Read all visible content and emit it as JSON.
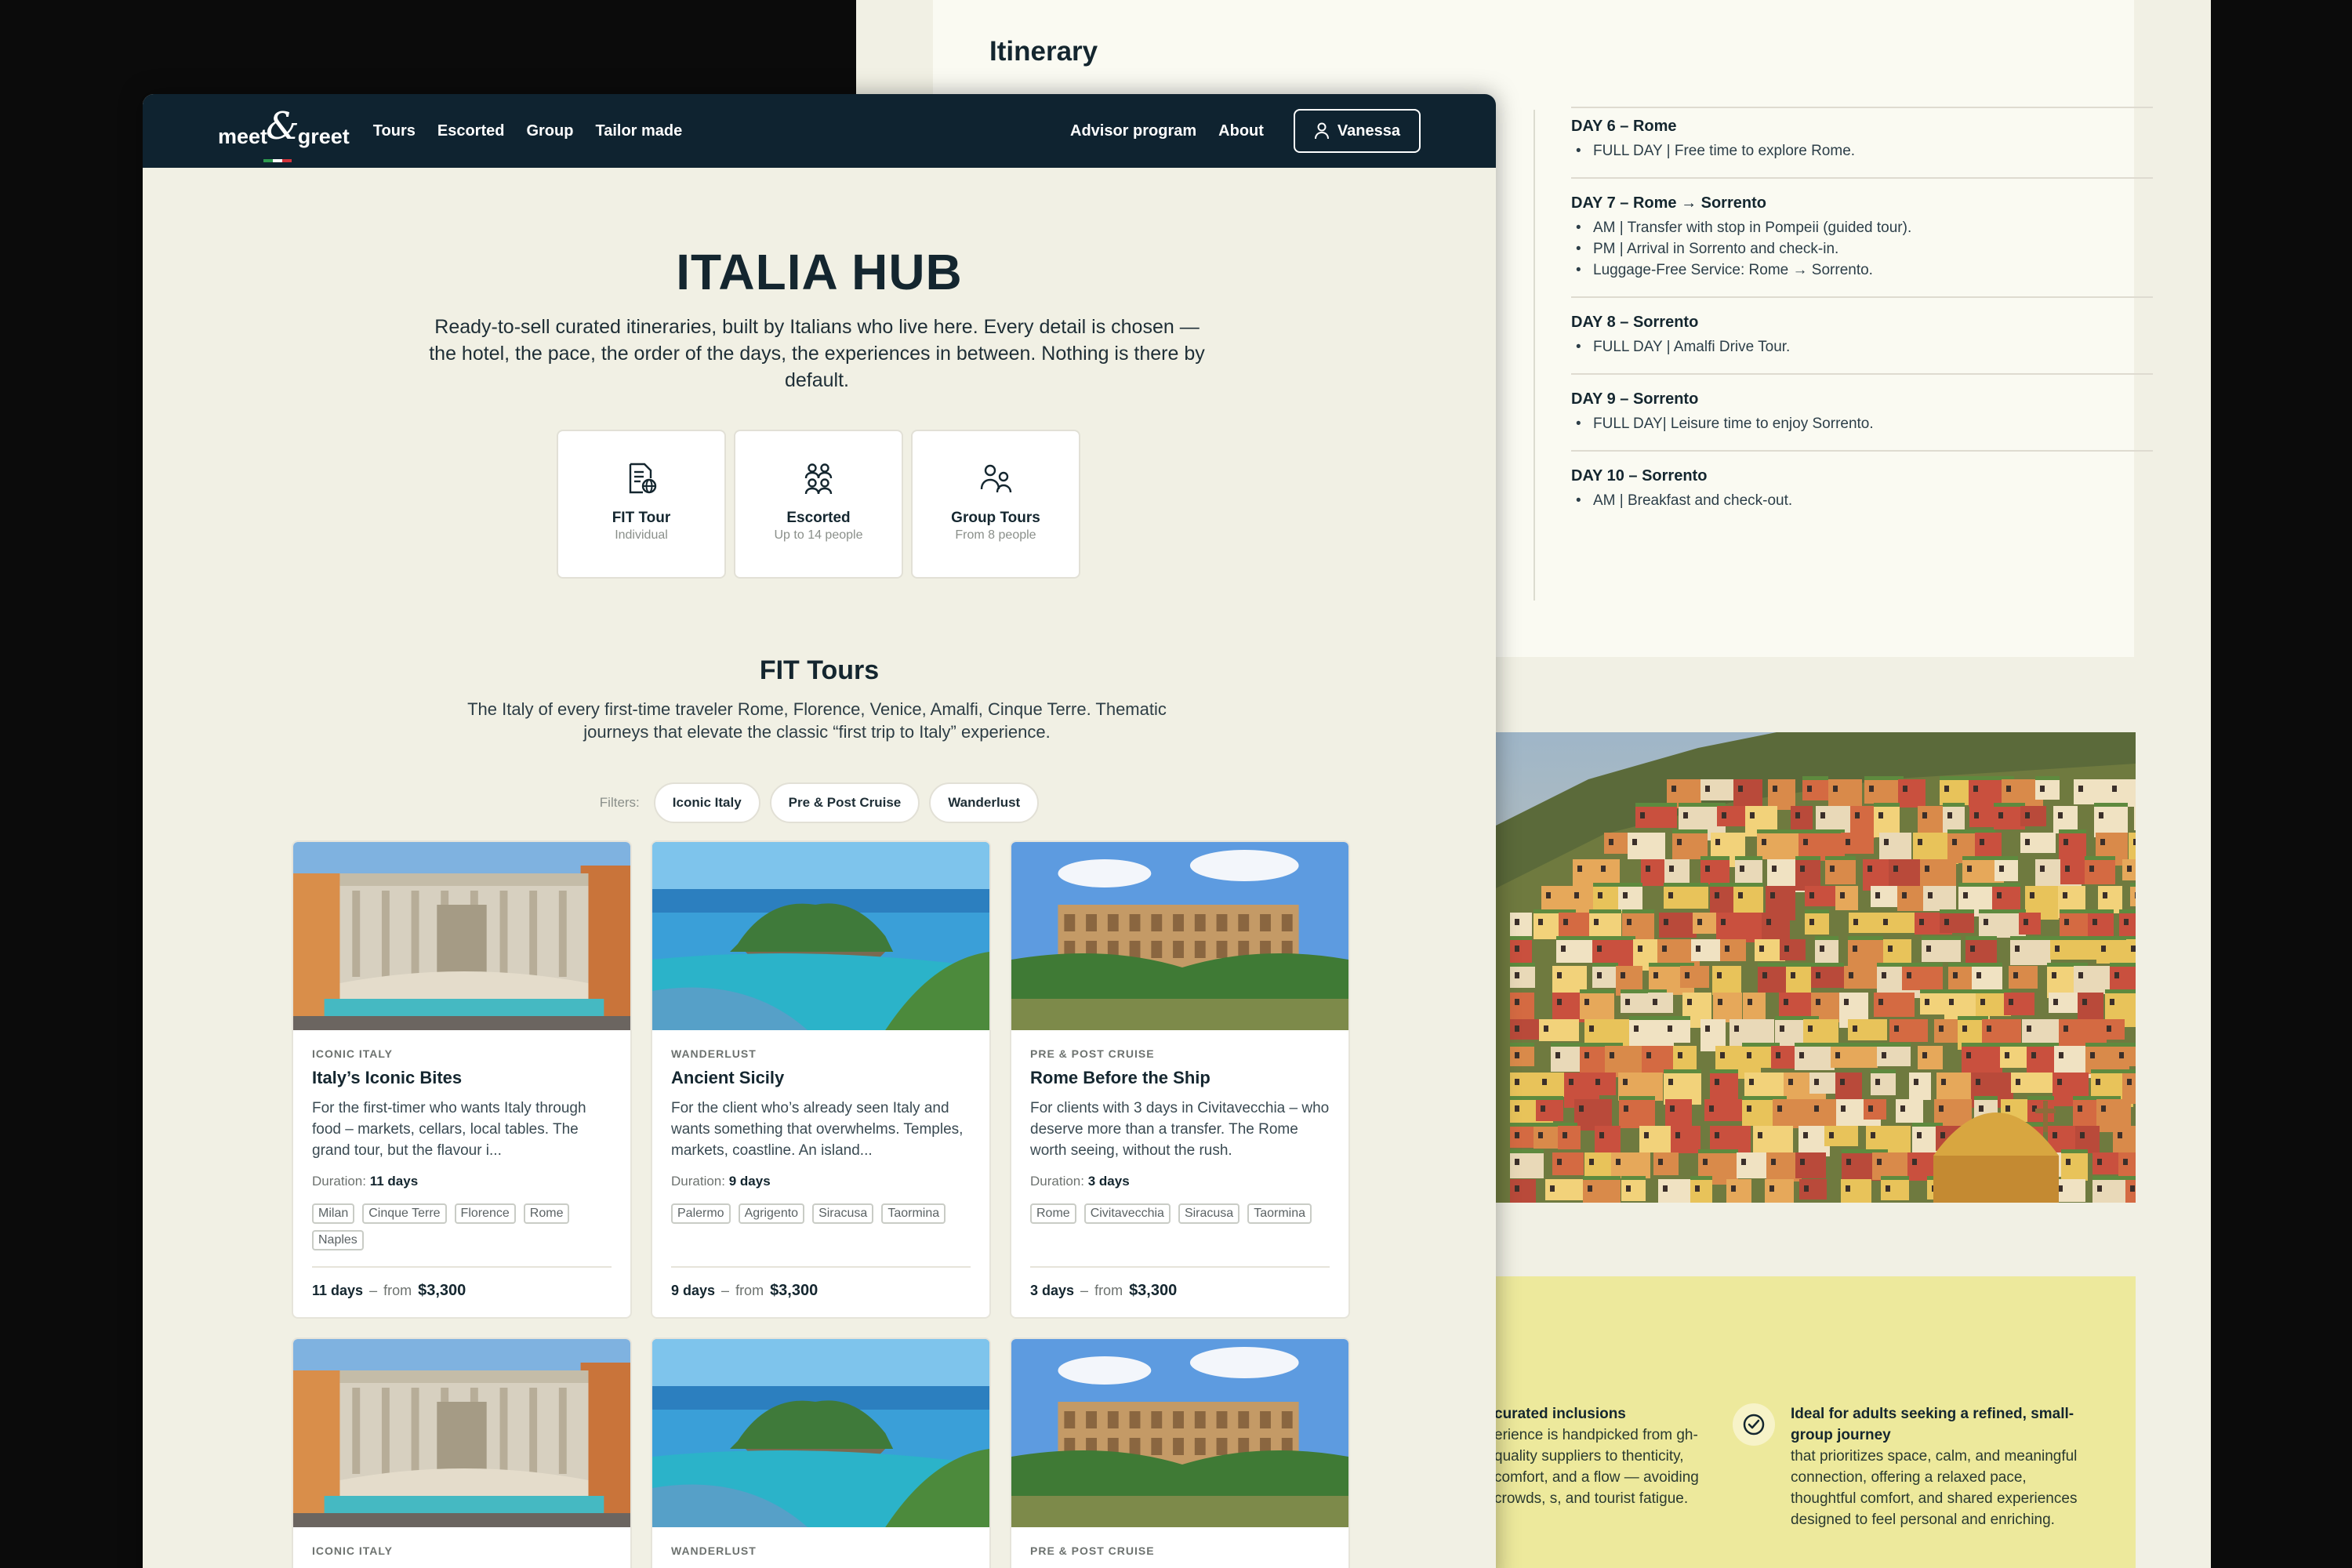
{
  "itinerary": {
    "title": "Itinerary",
    "days": [
      {
        "title": "DAY 6 – Rome",
        "items": [
          "FULL DAY | Free time to explore Rome."
        ]
      },
      {
        "title": "DAY 7 – Rome → Sorrento",
        "items": [
          "AM | Transfer with stop in Pompeii (guided tour).",
          "PM | Arrival in Sorrento and check-in.",
          "Luggage-Free Service: Rome → Sorrento."
        ]
      },
      {
        "title": "DAY 8 – Sorrento",
        "items": [
          "FULL DAY | Amalfi Drive Tour."
        ]
      },
      {
        "title": "DAY 9 – Sorrento",
        "items": [
          "FULL DAY| Leisure time to enjoy Sorrento."
        ]
      },
      {
        "title": "DAY 10 – Sorrento",
        "items": [
          "AM | Breakfast and check-out."
        ]
      }
    ]
  },
  "inclusions": {
    "left_title": "curated inclusions",
    "left_text": "erience is handpicked from gh-quality suppliers to thenticity, comfort, and a flow — avoiding crowds, s, and tourist fatigue.",
    "right_title": "Ideal for adults seeking a refined, small-group journey",
    "right_text": "that prioritizes space, calm, and meaningful connection, offering a relaxed pace, thoughtful comfort, and shared experiences designed to feel personal and enriching."
  },
  "nav": {
    "logo_left": "meet",
    "logo_amp": "&",
    "logo_right": "greet",
    "links": [
      "Tours",
      "Escorted",
      "Group",
      "Tailor made"
    ],
    "right_links": [
      "Advisor program",
      "About"
    ],
    "user": "Vanessa"
  },
  "hub": {
    "title": "ITALIA HUB",
    "description": "Ready-to-sell curated itineraries, built by Italians who live here. Every detail is chosen — the hotel, the pace, the order of the days, the experiences in between. Nothing is there by default."
  },
  "types": [
    {
      "name": "FIT Tour",
      "sub": "Individual",
      "icon": "document-globe-icon"
    },
    {
      "name": "Escorted",
      "sub": "Up to 14 people",
      "icon": "group-icon"
    },
    {
      "name": "Group Tours",
      "sub": "From 8 people",
      "icon": "users-icon"
    }
  ],
  "fit": {
    "title": "FIT Tours",
    "description": "The Italy of every first-time traveler Rome, Florence, Venice, Amalfi, Cinque Terre. Thematic journeys that elevate the classic “first trip to Italy” experience."
  },
  "filters": {
    "label": "Filters:",
    "options": [
      "Iconic Italy",
      "Pre & Post Cruise",
      "Wanderlust"
    ]
  },
  "tours": [
    {
      "category": "Iconic Italy",
      "name": "Italy’s Iconic Bites",
      "description": "For the first-timer who wants Italy through food – markets, cellars, local tables. The grand tour, but the flavour i...",
      "duration_label": "Duration:",
      "duration": "11 days",
      "tags": [
        "Milan",
        "Cinque Terre",
        "Florence",
        "Rome",
        "Naples"
      ],
      "days": "11 days",
      "sep": "–",
      "from": "from",
      "price": "$3,300",
      "image": "fountain"
    },
    {
      "category": "Wanderlust",
      "name": "Ancient Sicily",
      "description": "For the client who’s already seen Italy and wants something that overwhelms. Temples, markets, coastline. An island...",
      "duration_label": "Duration:",
      "duration": "9 days",
      "tags": [
        "Palermo",
        "Agrigento",
        "Siracusa",
        "Taormina"
      ],
      "days": "9 days",
      "sep": "–",
      "from": "from",
      "price": "$3,300",
      "image": "island"
    },
    {
      "category": "Pre & Post Cruise",
      "name": "Rome Before the Ship",
      "description": "For clients with 3 days in Civitavecchia – who deserve more than a transfer. The Rome worth seeing, without the rush.",
      "duration_label": "Duration:",
      "duration": "3 days",
      "tags": [
        "Rome",
        "Civitavecchia",
        "Siracusa",
        "Taormina"
      ],
      "days": "3 days",
      "sep": "–",
      "from": "from",
      "price": "$3,300",
      "image": "colosseum"
    },
    {
      "category": "Iconic Italy",
      "image": "fountain"
    },
    {
      "category": "Wanderlust",
      "image": "island"
    },
    {
      "category": "Pre & Post Cruise",
      "image": "colosseum"
    }
  ],
  "colors": {
    "navy": "#0f2330",
    "cream": "#f1f0e4",
    "yellow": "#ede99c",
    "flag_green": "#2e9b4f",
    "flag_white": "#ffffff",
    "flag_red": "#d2333b"
  }
}
